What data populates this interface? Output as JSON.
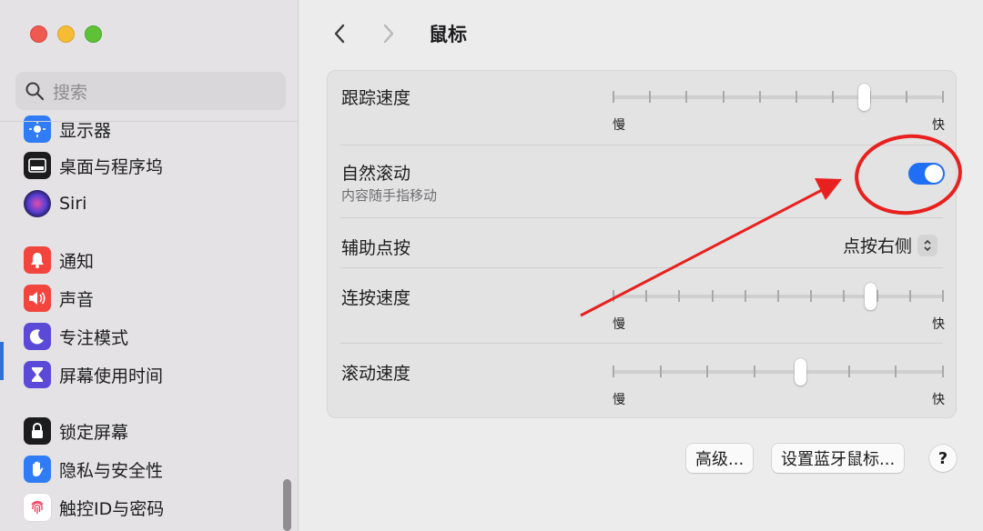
{
  "window": {
    "traffic_lights": [
      "close",
      "minimize",
      "zoom"
    ]
  },
  "sidebar": {
    "search_placeholder": "搜索",
    "items": [
      {
        "label": "显示器",
        "icon": "display-icon",
        "color": "#2f7cf6"
      },
      {
        "label": "桌面与程序坞",
        "icon": "dock-icon",
        "color": "#1c1c1e"
      },
      {
        "label": "Siri",
        "icon": "siri-icon",
        "color": "#2a2a6a"
      },
      {
        "label": "通知",
        "icon": "bell-icon",
        "color": "#f1453d"
      },
      {
        "label": "声音",
        "icon": "speaker-icon",
        "color": "#f1453d"
      },
      {
        "label": "专注模式",
        "icon": "moon-icon",
        "color": "#5b4ad8"
      },
      {
        "label": "屏幕使用时间",
        "icon": "hourglass-icon",
        "color": "#5b4ad8"
      },
      {
        "label": "锁定屏幕",
        "icon": "lock-icon",
        "color": "#1c1c1e"
      },
      {
        "label": "隐私与安全性",
        "icon": "hand-icon",
        "color": "#2f7cf6"
      },
      {
        "label": "触控ID与密码",
        "icon": "fingerprint-icon",
        "color": "#ffffff"
      }
    ]
  },
  "header": {
    "title": "鼠标"
  },
  "settings": {
    "tracking_speed": {
      "label": "跟踪速度",
      "min_label": "慢",
      "max_label": "快",
      "ticks": 10,
      "value_fraction": 0.77
    },
    "natural_scrolling": {
      "label": "自然滚动",
      "sublabel": "内容随手指移动",
      "on": true
    },
    "secondary_click": {
      "label": "辅助点按",
      "value": "点按右侧"
    },
    "double_click_speed": {
      "label": "连按速度",
      "min_label": "慢",
      "max_label": "快",
      "ticks": 11,
      "value_fraction": 0.79
    },
    "scroll_speed": {
      "label": "滚动速度",
      "min_label": "慢",
      "max_label": "快",
      "ticks": 8,
      "value_fraction": 0.57
    }
  },
  "buttons": {
    "advanced": "高级...",
    "setup_bluetooth_mouse": "设置蓝牙鼠标...",
    "help": "?"
  },
  "colors": {
    "accent": "#1e6ff5",
    "annotation": "#e8201e"
  }
}
